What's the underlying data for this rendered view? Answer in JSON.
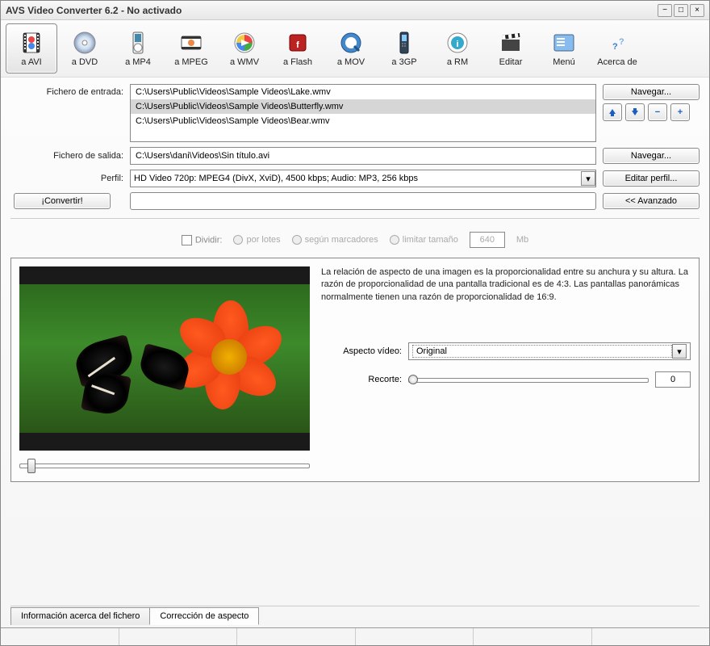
{
  "title": "AVS Video Converter 6.2 - No activado",
  "toolbar": [
    {
      "label": "a AVI",
      "selected": true,
      "icon": "film"
    },
    {
      "label": "a DVD",
      "selected": false,
      "icon": "disc"
    },
    {
      "label": "a MP4",
      "selected": false,
      "icon": "player"
    },
    {
      "label": "a MPEG",
      "selected": false,
      "icon": "film2"
    },
    {
      "label": "a WMV",
      "selected": false,
      "icon": "wmp"
    },
    {
      "label": "a Flash",
      "selected": false,
      "icon": "flash"
    },
    {
      "label": "a MOV",
      "selected": false,
      "icon": "qt"
    },
    {
      "label": "a 3GP",
      "selected": false,
      "icon": "phone"
    },
    {
      "label": "a RM",
      "selected": false,
      "icon": "real"
    },
    {
      "label": "Editar",
      "selected": false,
      "icon": "clapper"
    },
    {
      "label": "Menú",
      "selected": false,
      "icon": "menu"
    },
    {
      "label": "Acerca de",
      "selected": false,
      "icon": "help"
    }
  ],
  "labels": {
    "input_file": "Fichero de entrada:",
    "output_file": "Fichero de salida:",
    "profile": "Perfil:"
  },
  "input_files": [
    {
      "path": "C:\\Users\\Public\\Videos\\Sample Videos\\Lake.wmv",
      "selected": false
    },
    {
      "path": "C:\\Users\\Public\\Videos\\Sample Videos\\Butterfly.wmv",
      "selected": true
    },
    {
      "path": "C:\\Users\\Public\\Videos\\Sample Videos\\Bear.wmv",
      "selected": false
    }
  ],
  "output_file": "C:\\Users\\dani\\Videos\\Sin título.avi",
  "profile": "HD Video 720p: MPEG4 (DivX, XviD), 4500 kbps; Audio: MP3, 256 kbps",
  "buttons": {
    "browse": "Navegar...",
    "convert": "¡Convertir!",
    "edit_profile": "Editar perfil...",
    "advanced": "<< Avanzado"
  },
  "split": {
    "label": "Dividir:",
    "batch": "por lotes",
    "markers": "según marcadores",
    "limit": "limitar tamaño",
    "value": "640",
    "unit": "Mb"
  },
  "aspect": {
    "description": "La relación de aspecto de una imagen es la proporcionalidad entre su anchura y su altura. La razón de proporcionalidad de una pantalla tradicional es de 4:3. Las pantallas panorámicas normalmente tienen una razón de proporcionalidad de 16:9.",
    "video_label": "Aspecto vídeo:",
    "video_value": "Original",
    "crop_label": "Recorte:",
    "crop_value": "0"
  },
  "tabs": {
    "info": "Información acerca del fichero",
    "aspect": "Corrección de aspecto"
  }
}
